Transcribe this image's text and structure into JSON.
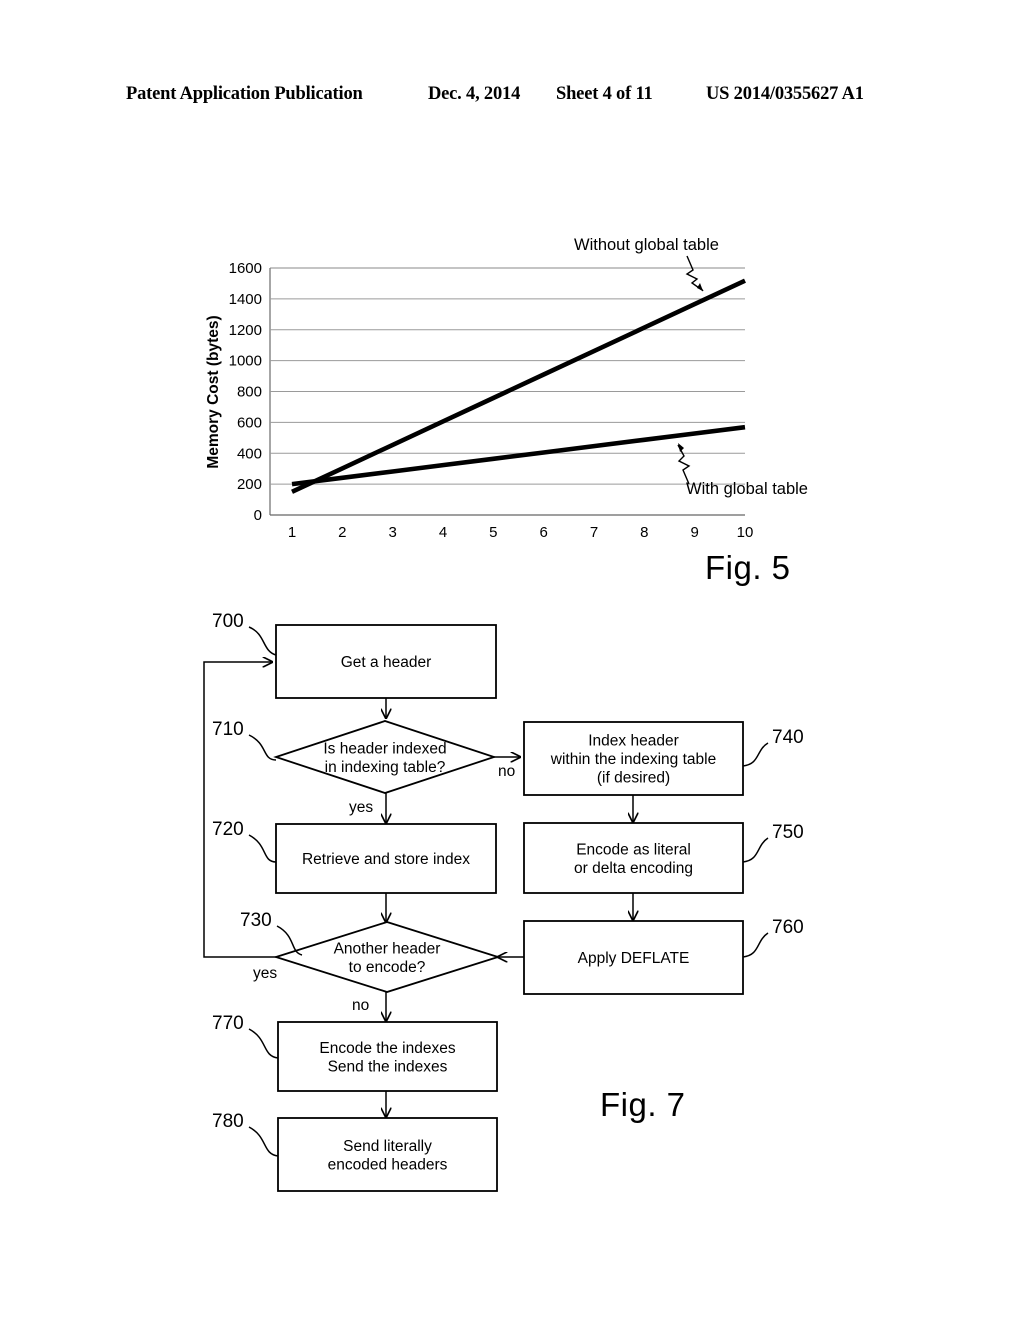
{
  "page_header": {
    "publication": "Patent Application Publication",
    "date": "Dec. 4, 2014",
    "sheet": "Sheet 4 of 11",
    "patent_number": "US 2014/0355627 A1"
  },
  "figure5": {
    "caption": "Fig. 5",
    "annotations": {
      "upper": "Without global table",
      "lower": "With global table"
    }
  },
  "chart_data": {
    "type": "line",
    "title": "",
    "xlabel": "",
    "ylabel": "Memory Cost (bytes)",
    "x": [
      1,
      2,
      3,
      4,
      5,
      6,
      7,
      8,
      9,
      10
    ],
    "xtick_labels": [
      "1",
      "2",
      "3",
      "4",
      "5",
      "6",
      "7",
      "8",
      "9",
      "10"
    ],
    "ytick_labels": [
      "0",
      "200",
      "400",
      "600",
      "800",
      "1000",
      "1200",
      "1400",
      "1600"
    ],
    "yticks": [
      0,
      200,
      400,
      600,
      800,
      1000,
      1200,
      1400,
      1600
    ],
    "ylim": [
      0,
      1600
    ],
    "xlim": [
      1,
      10
    ],
    "grid": "horizontal",
    "legend": "annotations",
    "series": [
      {
        "name": "Without global table",
        "values": [
          150,
          302,
          454,
          606,
          758,
          910,
          1062,
          1214,
          1366,
          1518
        ]
      },
      {
        "name": "With global table",
        "values": [
          200,
          241,
          282,
          323,
          364,
          405,
          446,
          487,
          528,
          569
        ]
      }
    ]
  },
  "figure7": {
    "caption": "Fig. 7",
    "nodes": [
      {
        "id": "700",
        "ref": "700",
        "shape": "process",
        "lines": [
          "Get a header"
        ]
      },
      {
        "id": "710",
        "ref": "710",
        "shape": "decision",
        "lines": [
          "Is header indexed",
          "in indexing table?"
        ]
      },
      {
        "id": "720",
        "ref": "720",
        "shape": "process",
        "lines": [
          "Retrieve and store index"
        ]
      },
      {
        "id": "730",
        "ref": "730",
        "shape": "decision",
        "lines": [
          "Another header",
          "to encode?"
        ]
      },
      {
        "id": "740",
        "ref": "740",
        "shape": "process",
        "lines": [
          "Index header",
          "within the indexing table",
          "(if desired)"
        ]
      },
      {
        "id": "750",
        "ref": "750",
        "shape": "process",
        "lines": [
          "Encode as literal",
          "or delta encoding"
        ]
      },
      {
        "id": "760",
        "ref": "760",
        "shape": "process",
        "lines": [
          "Apply DEFLATE"
        ]
      },
      {
        "id": "770",
        "ref": "770",
        "shape": "process",
        "lines": [
          "Encode the indexes",
          "Send the indexes"
        ]
      },
      {
        "id": "780",
        "ref": "780",
        "shape": "process",
        "lines": [
          "Send literally",
          "encoded headers"
        ]
      }
    ],
    "edge_labels": {
      "d710_no": "no",
      "d710_yes": "yes",
      "d730_yes": "yes",
      "d730_no": "no"
    }
  },
  "colors": {
    "ink": "#000000",
    "paper": "#ffffff",
    "gridline": "#9a9a9a",
    "axis": "#555555"
  }
}
